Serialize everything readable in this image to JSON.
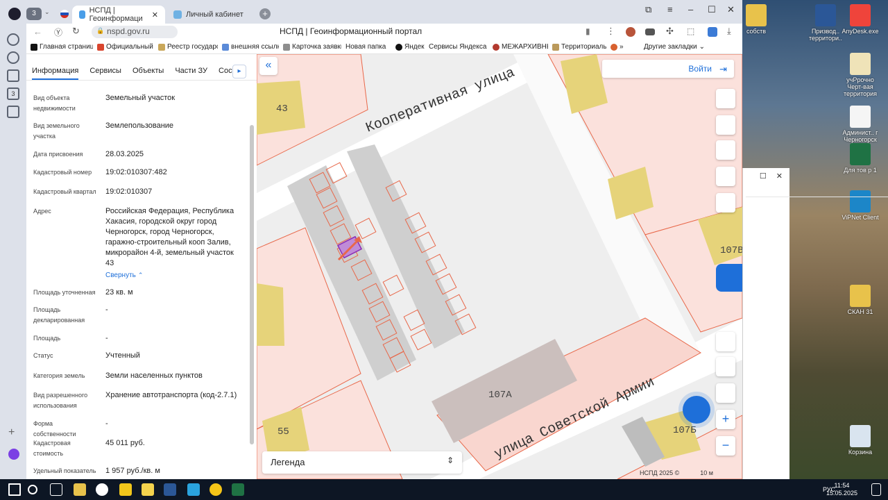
{
  "browser": {
    "tabs": [
      {
        "label": "НСПД | Геоинформаци",
        "active": true
      },
      {
        "label": "Личный кабинет",
        "active": false
      }
    ],
    "url": "nspd.gov.ru",
    "page_title": "НСПД | Геоинформационный портал",
    "bookmarks": [
      "Главная страница",
      "Официальный са",
      "Реестр государст",
      "внешняя ссылка",
      "Карточка заявки",
      "Новая папка",
      "Яндекс",
      "Сервисы Яндекса",
      "МЕЖАРХИВНЫЙ",
      "Территориальн"
    ],
    "bookmarks_more": "»",
    "other_bookmarks": "Другие закладки",
    "tab_count_badge": "3",
    "rail_badge": "3"
  },
  "panel": {
    "tabs": [
      "Информация",
      "Сервисы",
      "Объекты",
      "Части ЗУ",
      "Соста"
    ],
    "rows": [
      {
        "label": "Вид объекта недвижимости",
        "value": "Земельный участок"
      },
      {
        "label": "Вид земельного участка",
        "value": "Землепользование"
      },
      {
        "label": "Дата присвоения",
        "value": "28.03.2025"
      },
      {
        "label": "Кадастровый номер",
        "value": "19:02:010307:482"
      },
      {
        "label": "Кадастровый квартал",
        "value": "19:02:010307"
      },
      {
        "label": "Адрес",
        "value": "Российская Федерация, Республика Хакасия, городской округ город Черногорск, город Черногорск, гаражно-строительный кооп Залив, микрорайон 4-й, земельный участок 43"
      },
      {
        "label": "Площадь уточненная",
        "value": "23 кв. м"
      },
      {
        "label": "Площадь декларированная",
        "value": "-"
      },
      {
        "label": "Площадь",
        "value": "-"
      },
      {
        "label": "Статус",
        "value": "Учтенный"
      },
      {
        "label": "Категория земель",
        "value": "Земли населенных пунктов"
      },
      {
        "label": "Вид разрешенного использования",
        "value": "Хранение автотранспорта (код-2.7.1)"
      },
      {
        "label": "Форма собственности",
        "value": "-"
      },
      {
        "label": "Кадастровая стоимость",
        "value": "45 011 руб."
      },
      {
        "label": "Удельный показатель",
        "value": "1 957 руб./кв. м"
      }
    ],
    "collapse_label": "Свернуть"
  },
  "map": {
    "login_label": "Войти",
    "legend_label": "Легенда",
    "street_1": "Кооперативная улица",
    "street_2": "улица Советской Армии",
    "labels": [
      "43",
      "55",
      "107А",
      "107Б",
      "107В"
    ],
    "copyright": "НСПД 2025 ©",
    "scale": "10 м",
    "accent": "#1e6fd9",
    "parcel_color": "#e8684a",
    "building_color": "#e6d37a"
  },
  "desktop": {
    "icons": [
      "собств",
      "Призвод.. территори..",
      "AnyDesk.exe",
      "учРрочно Черт-вая территория",
      "Админист.. г Черногорск",
      "Для тов р 1",
      "ViPNet Client",
      "СКАН 31",
      "Корзина"
    ]
  },
  "taskbar": {
    "time": "11:54",
    "date": "15.05.2025",
    "lang": "РУС"
  }
}
